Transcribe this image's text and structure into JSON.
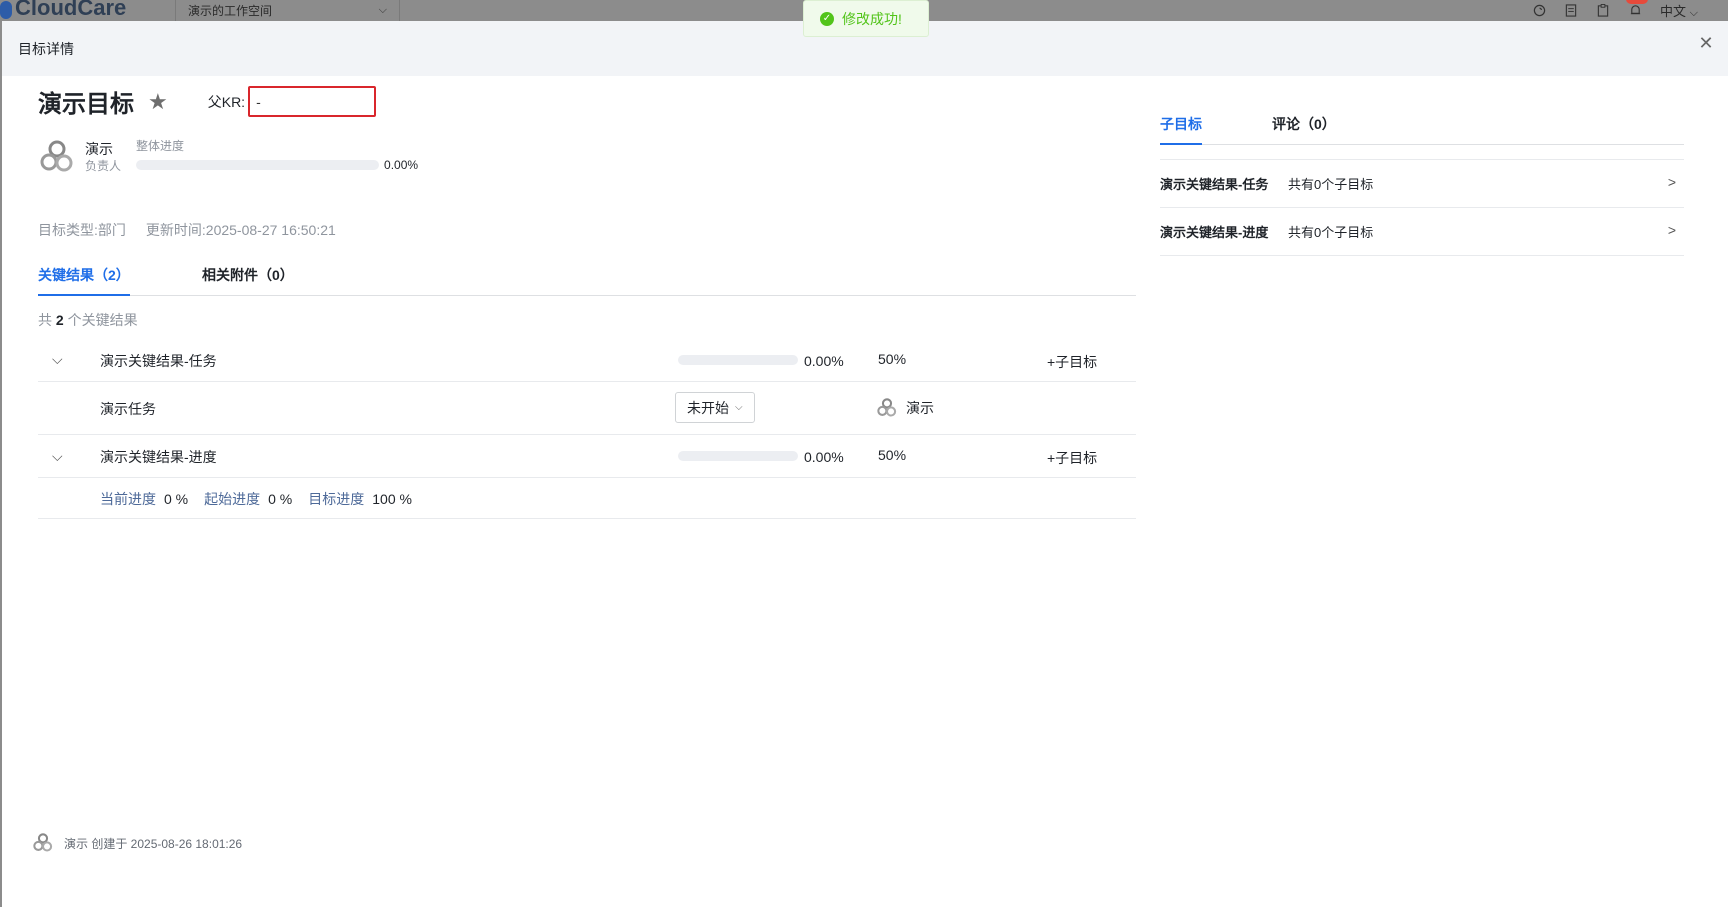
{
  "app": {
    "logo": "CloudCare",
    "workspace": "演示的工作空间",
    "language": "中文"
  },
  "toast": {
    "message": "修改成功!"
  },
  "drawer": {
    "title": "目标详情"
  },
  "goal": {
    "title": "演示目标",
    "parent_kr_label": "父KR:",
    "parent_kr_value": "-",
    "owner_name": "演示",
    "owner_role": "负责人",
    "progress_label": "整体进度",
    "progress_text": "0.00%",
    "progress_fraction": 0,
    "type_label": "目标类型:",
    "type_value": "部门",
    "updated_label": "更新时间:",
    "updated_value": "2025-08-27 16:50:21"
  },
  "left_tabs": [
    {
      "label": "关键结果（2）",
      "active": true
    },
    {
      "label": "相关附件（0）",
      "active": false
    }
  ],
  "kr_summary": {
    "prefix": "共",
    "count": "2",
    "suffix": "个关键结果"
  },
  "key_results": [
    {
      "name": "演示关键结果-任务",
      "progress_text": "0.00%",
      "progress_fraction": 0,
      "weight": "50%",
      "add_label": "+子目标",
      "task": {
        "name": "演示任务",
        "status": "未开始",
        "assignee": "演示"
      }
    },
    {
      "name": "演示关键结果-进度",
      "progress_text": "0.00%",
      "progress_fraction": 0,
      "weight": "50%",
      "add_label": "+子目标",
      "detail": {
        "current_label": "当前进度",
        "current_value": "0 %",
        "start_label": "起始进度",
        "start_value": "0 %",
        "target_label": "目标进度",
        "target_value": "100 %"
      }
    }
  ],
  "right_tabs": [
    {
      "label": "子目标",
      "active": true
    },
    {
      "label": "评论（0）",
      "active": false
    }
  ],
  "sub_goals": [
    {
      "name": "演示关键结果-任务",
      "count_text": "共有0个子目标"
    },
    {
      "name": "演示关键结果-进度",
      "count_text": "共有0个子目标"
    }
  ],
  "footer": {
    "text": "演示 创建于 2025-08-26 18:01:26"
  },
  "colors": {
    "accent": "#1f6ee8",
    "success": "#52c41a",
    "highlight_border": "#d9262c"
  }
}
